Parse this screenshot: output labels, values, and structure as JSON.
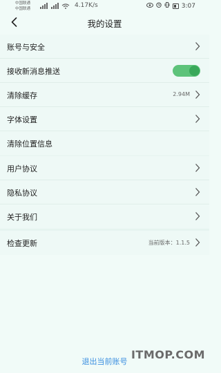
{
  "status_bar": {
    "carrier_1": "中国联通",
    "carrier_2": "中国联通",
    "network_speed": "4.17K/s",
    "time": "3:07"
  },
  "header": {
    "title": "我的设置"
  },
  "settings": {
    "group1": [
      {
        "label": "账号与安全",
        "value": "",
        "control": "chevron"
      },
      {
        "label": "接收新消息推送",
        "value": "",
        "control": "toggle",
        "on": true
      },
      {
        "label": "清除缓存",
        "value": "2.94M",
        "control": "chevron"
      },
      {
        "label": "字体设置",
        "value": "",
        "control": "chevron"
      },
      {
        "label": "清除位置信息",
        "value": "",
        "control": "none"
      }
    ],
    "group2": [
      {
        "label": "用户协议",
        "value": "",
        "control": "chevron"
      },
      {
        "label": "隐私协议",
        "value": "",
        "control": "chevron"
      },
      {
        "label": "关于我们",
        "value": "",
        "control": "chevron"
      }
    ],
    "group3": [
      {
        "label": "检查更新",
        "value": "当前版本：1.1.5",
        "control": "chevron"
      }
    ]
  },
  "footer": {
    "logout_label": "退出当前账号",
    "watermark": "ITMOP.COM"
  },
  "colors": {
    "background": "#f1fbf8",
    "toggle_on": "#5dc37a",
    "logout_text": "#3b8fe0"
  }
}
